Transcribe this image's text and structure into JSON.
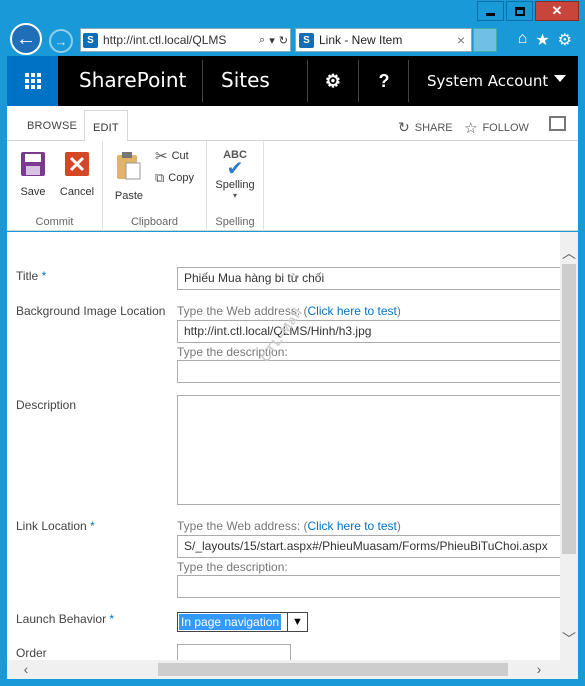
{
  "browser": {
    "address_url": "http://int.ctl.local/QLMS",
    "search_glyph": "⌕",
    "dropdown_glyph": "▾",
    "refresh_glyph": "↻",
    "tab_title": "Link - New Item",
    "tab_close": "×"
  },
  "suite_bar": {
    "brand": "SharePoint",
    "sites": "Sites",
    "settings_glyph": "⚙",
    "help_glyph": "?",
    "account": "System Account"
  },
  "ribbon_tabs": {
    "browse": "BROWSE",
    "edit": "EDIT",
    "share": "SHARE",
    "follow": "FOLLOW"
  },
  "ribbon": {
    "commit": {
      "label": "Commit",
      "save": "Save",
      "cancel": "Cancel"
    },
    "clipboard": {
      "label": "Clipboard",
      "paste": "Paste",
      "cut": "Cut",
      "copy": "Copy"
    },
    "spelling": {
      "label": "Spelling",
      "button": "Spelling",
      "abc": "ABC"
    }
  },
  "form": {
    "title": {
      "label": "Title",
      "required": "*",
      "value": "Phiếu Mua hàng bi từ chối"
    },
    "background_image": {
      "label": "Background Image Location",
      "hint_address": "Type the Web address: (",
      "test_link": "Click here to test",
      "hint_close": ")",
      "url_value": "http://int.ctl.local/QLMS/Hinh/h3.jpg",
      "hint_description": "Type the description:",
      "description_value": ""
    },
    "description": {
      "label": "Description",
      "value": ""
    },
    "link_location": {
      "label": "Link Location",
      "required": "*",
      "hint_address": "Type the Web address: (",
      "test_link": "Click here to test",
      "hint_close": ")",
      "url_value": "S/_layouts/15/start.aspx#/PhieuMuasam/Forms/PhieuBiTuChoi.aspx",
      "hint_description": "Type the description:",
      "description_value": ""
    },
    "launch_behavior": {
      "label": "Launch Behavior",
      "required": "*",
      "selected": "In page navigation"
    },
    "order": {
      "label": "Order",
      "value": ""
    }
  },
  "watermark": "CTL-Mall",
  "colors": {
    "window_frame": "#1a99d8",
    "suite_bar": "#000000",
    "app_launcher": "#0072c6",
    "accent_link": "#0072c6"
  }
}
